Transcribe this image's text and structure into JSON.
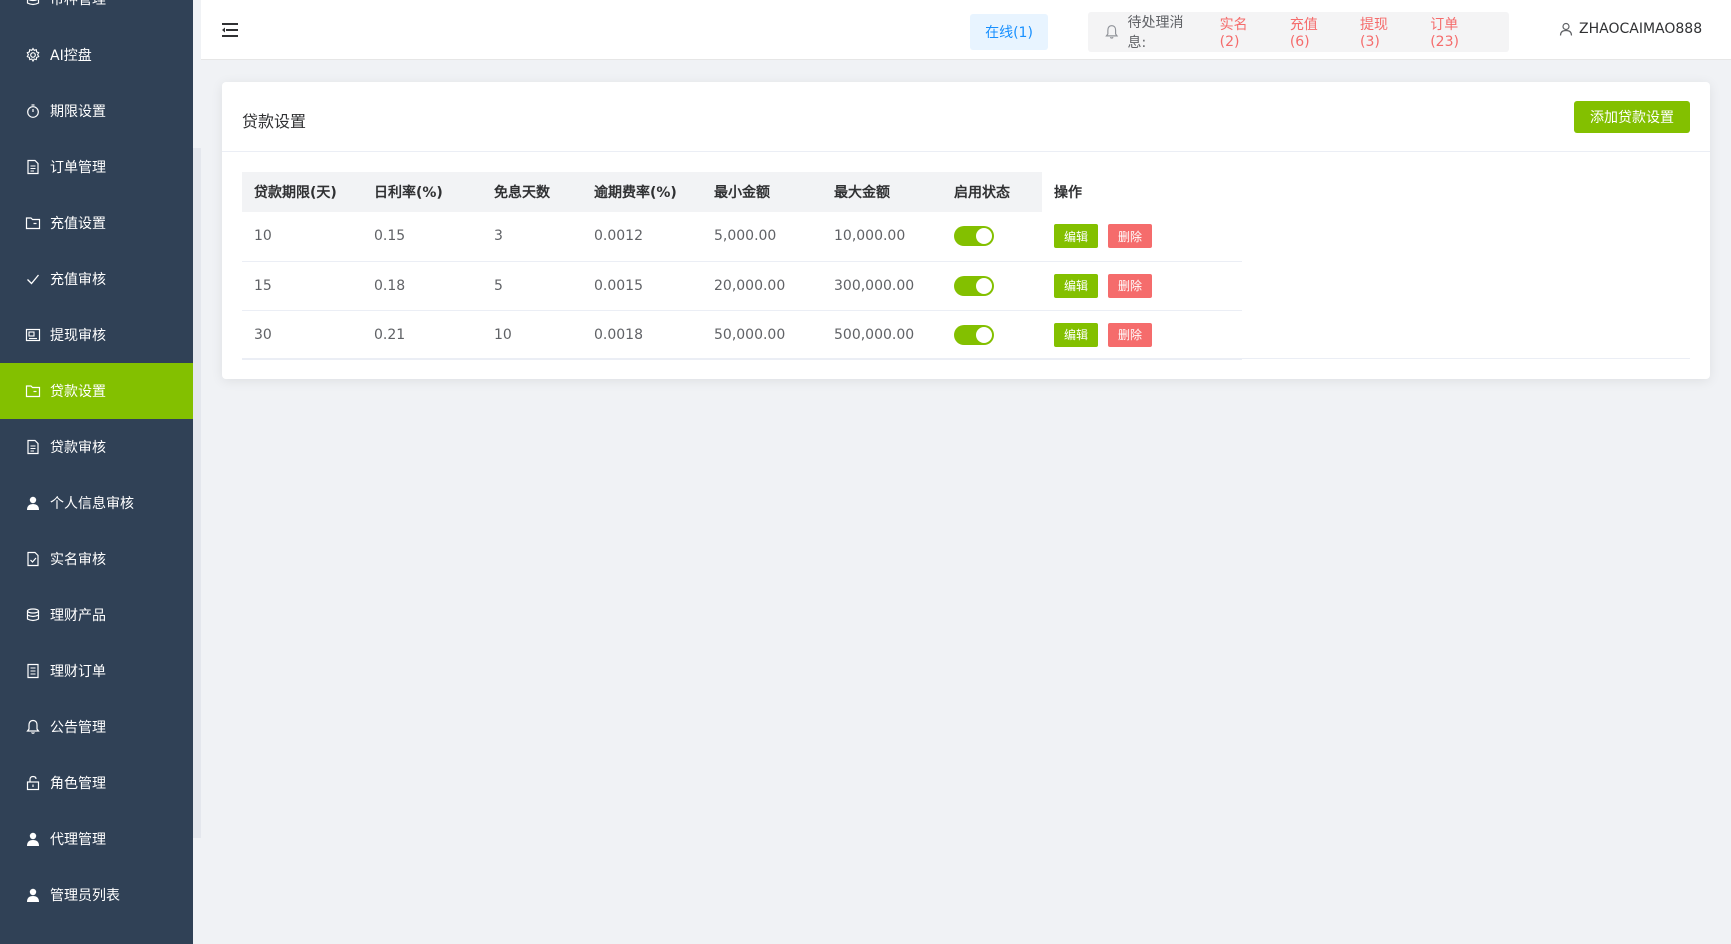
{
  "colors": {
    "sidebar_bg": "#304156",
    "accent_green": "#83c000",
    "danger_red": "#f56c6c",
    "online_blue": "#1890ff"
  },
  "sidebar": {
    "items": [
      {
        "label": "币种管理",
        "icon": "database-icon"
      },
      {
        "label": "AI控盘",
        "icon": "gear-icon"
      },
      {
        "label": "期限设置",
        "icon": "stopwatch-icon"
      },
      {
        "label": "订单管理",
        "icon": "document-icon"
      },
      {
        "label": "充值设置",
        "icon": "folder-icon"
      },
      {
        "label": "充值审核",
        "icon": "check-icon"
      },
      {
        "label": "提现审核",
        "icon": "postcard-icon"
      },
      {
        "label": "贷款设置",
        "icon": "folder-icon",
        "active": true
      },
      {
        "label": "贷款审核",
        "icon": "document-icon"
      },
      {
        "label": "个人信息审核",
        "icon": "user-solid-icon"
      },
      {
        "label": "实名审核",
        "icon": "document-checked-icon"
      },
      {
        "label": "理财产品",
        "icon": "coin-icon"
      },
      {
        "label": "理财订单",
        "icon": "tickets-icon"
      },
      {
        "label": "公告管理",
        "icon": "bell-icon"
      },
      {
        "label": "角色管理",
        "icon": "unlock-icon"
      },
      {
        "label": "代理管理",
        "icon": "user-solid-icon"
      },
      {
        "label": "管理员列表",
        "icon": "user-solid-icon"
      }
    ]
  },
  "header": {
    "online": "在线(1)",
    "pending_label": "待处理消息:",
    "pending_links": [
      "实名(2)",
      "充值(6)",
      "提现(3)",
      "订单(23)"
    ],
    "username": "ZHAOCAIMAO888"
  },
  "card": {
    "title": "贷款设置",
    "add_button": "添加贷款设置"
  },
  "table": {
    "headers": [
      "贷款期限(天)",
      "日利率(%)",
      "免息天数",
      "逾期费率(%)",
      "最小金额",
      "最大金额",
      "启用状态",
      "操作"
    ],
    "rows": [
      {
        "term": "10",
        "rate": "0.15",
        "free_days": "3",
        "overdue": "0.0012",
        "min": "5,000.00",
        "max": "10,000.00",
        "enabled": true
      },
      {
        "term": "15",
        "rate": "0.18",
        "free_days": "5",
        "overdue": "0.0015",
        "min": "20,000.00",
        "max": "300,000.00",
        "enabled": true
      },
      {
        "term": "30",
        "rate": "0.21",
        "free_days": "10",
        "overdue": "0.0018",
        "min": "50,000.00",
        "max": "500,000.00",
        "enabled": true
      }
    ],
    "edit_label": "编辑",
    "delete_label": "删除"
  }
}
